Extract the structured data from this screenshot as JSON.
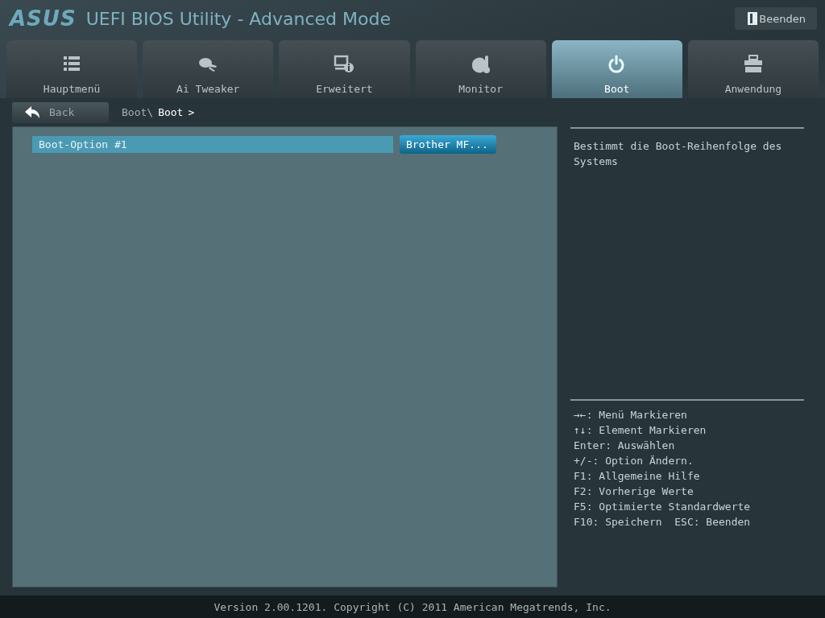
{
  "header": {
    "logo": "ASUS",
    "title": "UEFI BIOS Utility - Advanced Mode",
    "exit_button": "Beenden"
  },
  "tabs": [
    {
      "label": "Hauptmenü",
      "selected": false
    },
    {
      "label": "Ai Tweaker",
      "selected": false
    },
    {
      "label": "Erweitert",
      "selected": false
    },
    {
      "label": "Monitor",
      "selected": false
    },
    {
      "label": "Boot",
      "selected": true
    },
    {
      "label": "Anwendung",
      "selected": false
    }
  ],
  "back_button": "Back",
  "breadcrumb": {
    "parent": "Boot\\",
    "current": "Boot",
    "separator": ">"
  },
  "settings": [
    {
      "label": "Boot-Option #1",
      "value": "Brother MF...",
      "selected": true
    }
  ],
  "description": "Bestimmt die Boot-Reihenfolge des Systems",
  "key_help": [
    "→←: Menü Markieren",
    "↑↓: Element Markieren",
    "Enter: Auswählen",
    "+/-: Option Ändern.",
    "F1: Allgemeine Hilfe",
    "F2: Vorherige Werte",
    "F5: Optimierte Standardwerte",
    "F10: Speichern  ESC: Beenden"
  ],
  "footer": "Version 2.00.1201. Copyright (C) 2011 American Megatrends, Inc."
}
